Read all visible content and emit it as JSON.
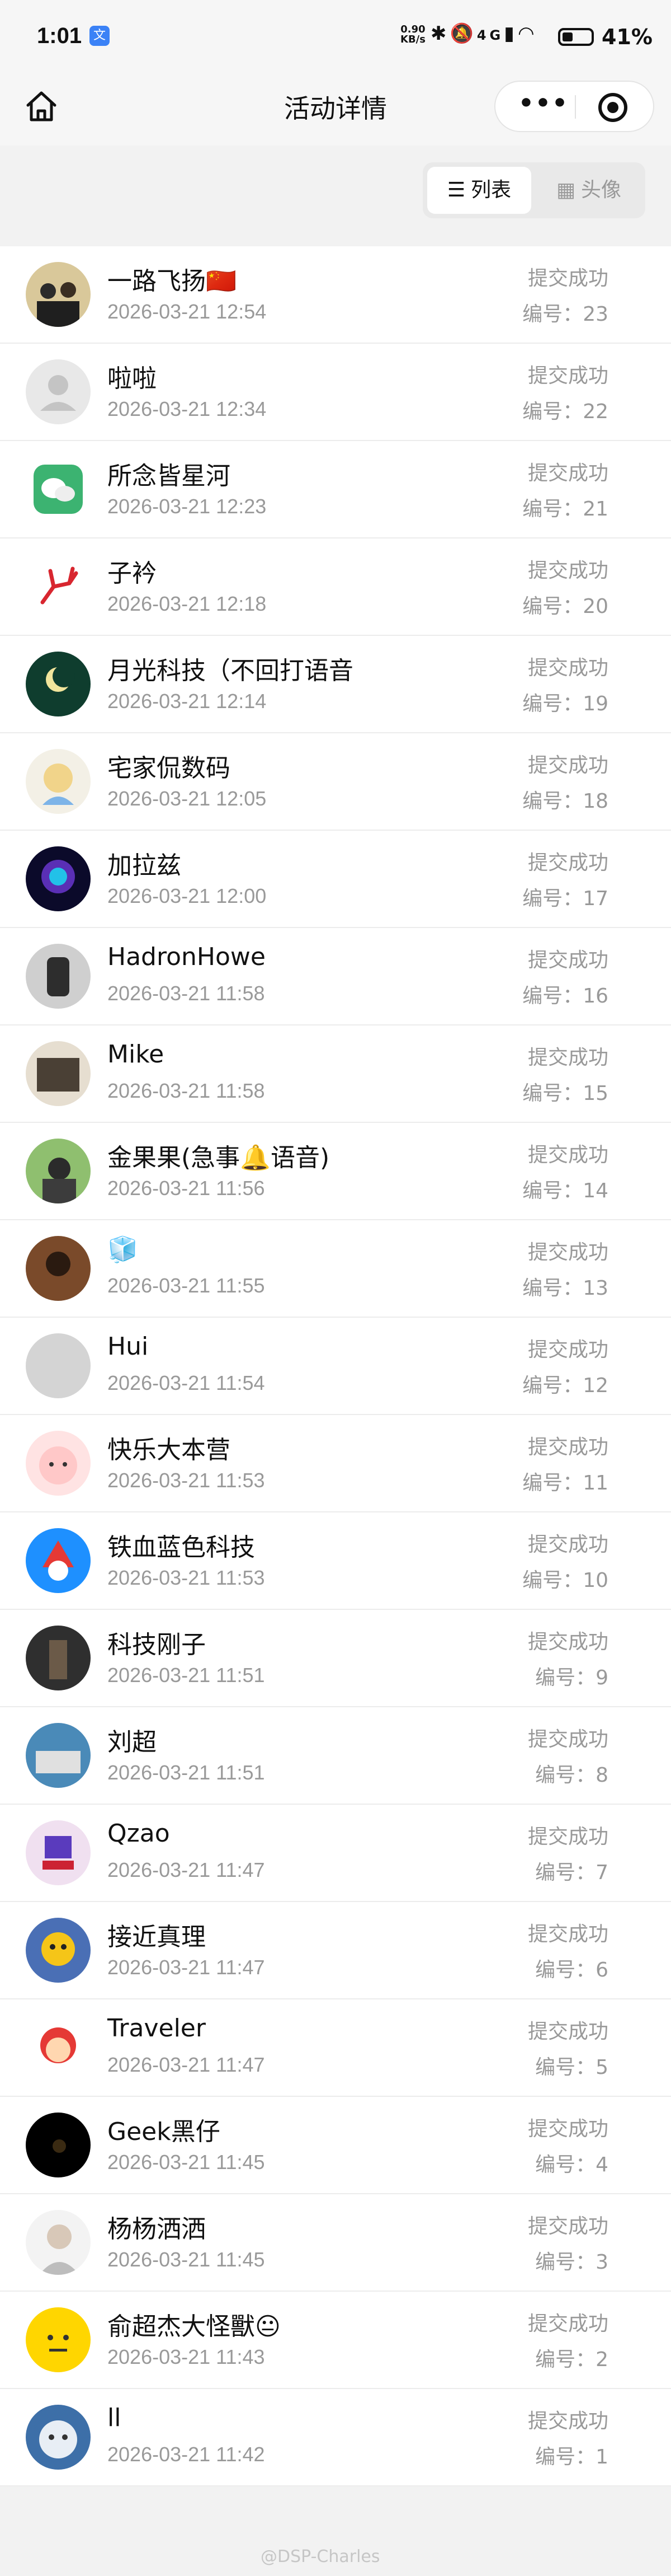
{
  "status_bar": {
    "time": "1:01",
    "speed_value": "0.90",
    "speed_unit": "KB/s",
    "network": "4G",
    "battery": "41%"
  },
  "nav": {
    "title": "活动详情",
    "capsule_more": "•••"
  },
  "view_toggle": {
    "list_label": "列表",
    "avatar_label": "头像",
    "active": "list"
  },
  "records": [
    {
      "name": "一路飞扬🇨🇳",
      "time": "2026-03-21 12:54",
      "status": "提交成功",
      "number": "编号：23"
    },
    {
      "name": "啦啦",
      "time": "2026-03-21 12:34",
      "status": "提交成功",
      "number": "编号：22"
    },
    {
      "name": "所念皆星河",
      "time": "2026-03-21 12:23",
      "status": "提交成功",
      "number": "编号：21"
    },
    {
      "name": "子衿",
      "time": "2026-03-21 12:18",
      "status": "提交成功",
      "number": "编号：20"
    },
    {
      "name": "月光科技（不回打语音",
      "time": "2026-03-21 12:14",
      "status": "提交成功",
      "number": "编号：19"
    },
    {
      "name": "宅家侃数码",
      "time": "2026-03-21 12:05",
      "status": "提交成功",
      "number": "编号：18"
    },
    {
      "name": "加拉兹",
      "time": "2026-03-21 12:00",
      "status": "提交成功",
      "number": "编号：17"
    },
    {
      "name": "HadronHowe",
      "time": "2026-03-21 11:58",
      "status": "提交成功",
      "number": "编号：16"
    },
    {
      "name": "Mike",
      "time": "2026-03-21 11:58",
      "status": "提交成功",
      "number": "编号：15"
    },
    {
      "name": "金果果(急事🔔语音)",
      "time": "2026-03-21 11:56",
      "status": "提交成功",
      "number": "编号：14"
    },
    {
      "name": "🧊",
      "time": "2026-03-21 11:55",
      "status": "提交成功",
      "number": "编号：13"
    },
    {
      "name": "Hui",
      "time": "2026-03-21 11:54",
      "status": "提交成功",
      "number": "编号：12"
    },
    {
      "name": "快乐大本营",
      "time": "2026-03-21 11:53",
      "status": "提交成功",
      "number": "编号：11"
    },
    {
      "name": "铁血蓝色科技",
      "time": "2026-03-21 11:53",
      "status": "提交成功",
      "number": "编号：10"
    },
    {
      "name": "科技刚子",
      "time": "2026-03-21 11:51",
      "status": "提交成功",
      "number": "编号：9"
    },
    {
      "name": "刘超",
      "time": "2026-03-21 11:51",
      "status": "提交成功",
      "number": "编号：8"
    },
    {
      "name": "Qzao",
      "time": "2026-03-21 11:47",
      "status": "提交成功",
      "number": "编号：7"
    },
    {
      "name": "接近真理",
      "time": "2026-03-21 11:47",
      "status": "提交成功",
      "number": "编号：6"
    },
    {
      "name": "Traveler",
      "time": "2026-03-21 11:47",
      "status": "提交成功",
      "number": "编号：5"
    },
    {
      "name": "Geek黑仔",
      "time": "2026-03-21 11:45",
      "status": "提交成功",
      "number": "编号：4"
    },
    {
      "name": "杨杨洒洒",
      "time": "2026-03-21 11:45",
      "status": "提交成功",
      "number": "编号：3"
    },
    {
      "name": "俞超杰大怪獸😐",
      "time": "2026-03-21 11:43",
      "status": "提交成功",
      "number": "编号：2"
    },
    {
      "name": "ll",
      "time": "2026-03-21 11:42",
      "status": "提交成功",
      "number": "编号：1"
    }
  ],
  "watermark": "@DSP-Charles"
}
